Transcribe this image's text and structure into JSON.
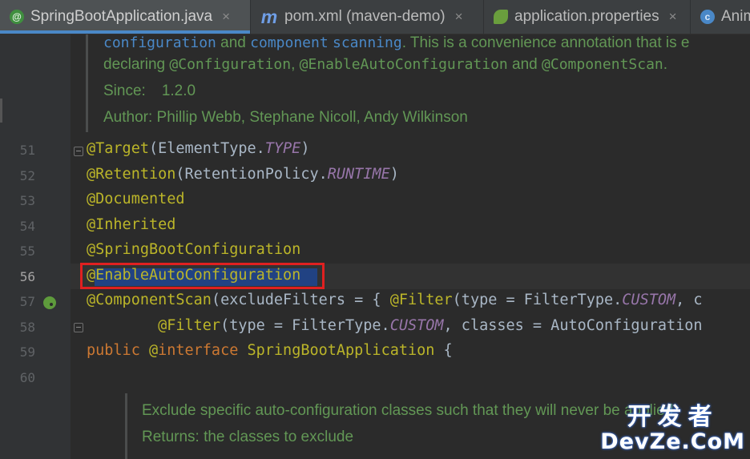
{
  "tabs": [
    {
      "label": "SpringBootApplication.java",
      "icon": "annotation-icon",
      "icon_glyph": "@",
      "active": true,
      "closable": true
    },
    {
      "label": "pom.xml (maven-demo)",
      "icon": "maven-icon",
      "icon_glyph": "m",
      "active": false,
      "closable": true
    },
    {
      "label": "application.properties",
      "icon": "spring-config-icon",
      "icon_glyph": "",
      "active": false,
      "closable": true
    },
    {
      "label": "Anim",
      "icon": "class-icon",
      "icon_glyph": "c",
      "active": false,
      "closable": false
    }
  ],
  "tab_close_glyph": "×",
  "doc_top": {
    "line1": {
      "p1": "configuration",
      "p2": " and ",
      "p3": "component",
      "p4": " ",
      "p5": "scanning",
      "p6": ". This is a convenience annotation that is e"
    },
    "line2": {
      "p1": "declaring ",
      "p2": "@Configuration",
      "p3": ", ",
      "p4": "@EnableAutoConfiguration",
      "p5": " and ",
      "p6": "@ComponentScan",
      "p7": "."
    },
    "since_label": "Since:",
    "since_value": "1.2.0",
    "author": "Author: Phillip Webb, Stephane Nicoll, Andy Wilkinson"
  },
  "lines": {
    "n51": "51",
    "n52": "52",
    "n53": "53",
    "n54": "54",
    "n55": "55",
    "n56": "56",
    "n57": "57",
    "n58": "58",
    "n59": "59",
    "n60": "60"
  },
  "code": {
    "l51": {
      "a": "@Target",
      "t1": "(ElementType.",
      "c": "TYPE",
      "t2": ")"
    },
    "l52": {
      "a": "@Retention",
      "t1": "(RetentionPolicy.",
      "c": "RUNTIME",
      "t2": ")"
    },
    "l53": {
      "a": "@Documented"
    },
    "l54": {
      "a": "@Inherited"
    },
    "l55": {
      "a": "@SpringBootConfiguration"
    },
    "l56": {
      "at": "@",
      "rest": "EnableAutoConfiguration"
    },
    "l57": {
      "a1": "@ComponentScan",
      "t1": "(excludeFilters = { ",
      "a2": "@Filter",
      "t2": "(type = FilterType.",
      "c": "CUSTOM",
      "t3": ", c"
    },
    "l58": {
      "indent": "        ",
      "a": "@Filter",
      "t1": "(type = FilterType.",
      "c": "CUSTOM",
      "t2": ", classes = AutoConfiguration"
    },
    "l59": {
      "k": "public",
      "t1": " ",
      "a": "@",
      "k2": "interface",
      "t2": " ",
      "name": "SpringBootApplication",
      "t3": " {"
    }
  },
  "doc_bottom": {
    "line1": "Exclude specific auto-configuration classes such that they will never be applied.",
    "line2": "Returns: the classes to exclude"
  },
  "watermark": {
    "line1": "开发者",
    "line2": "DevZe.CoM"
  },
  "colors": {
    "background": "#2b2b2b",
    "gutter": "#313335",
    "annotation": "#bbb529",
    "keyword": "#cc7832",
    "constant": "#9876aa",
    "doc_text": "#629755",
    "selection": "#214283",
    "highlight_box": "#e02020"
  }
}
